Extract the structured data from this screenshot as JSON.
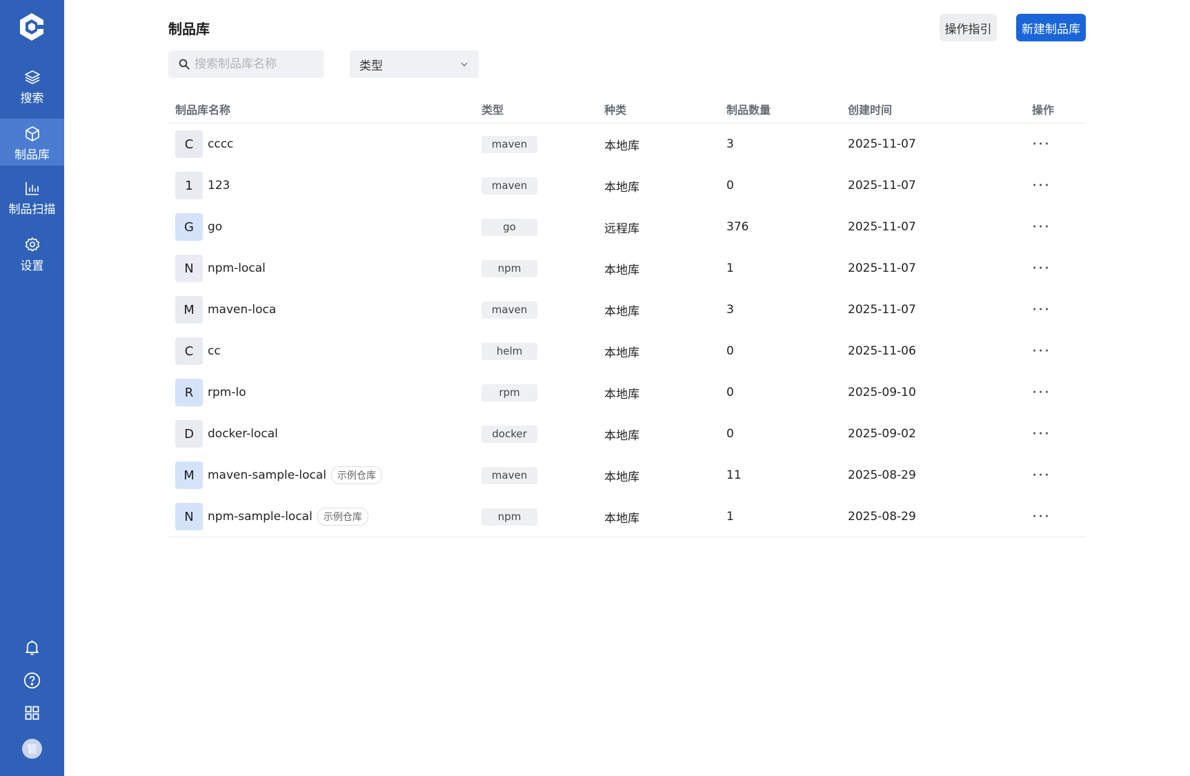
{
  "sidebar": {
    "items": [
      {
        "label": "搜索",
        "icon": "layers-icon"
      },
      {
        "label": "制品库",
        "icon": "box-icon"
      },
      {
        "label": "制品扫描",
        "icon": "bar-chart-icon"
      },
      {
        "label": "设置",
        "icon": "gear-icon"
      }
    ],
    "avatar_text": "管"
  },
  "header": {
    "title": "制品库",
    "guide_label": "操作指引",
    "new_label": "新建制品库"
  },
  "filters": {
    "search_placeholder": "搜索制品库名称",
    "type_label": "类型"
  },
  "table": {
    "columns": [
      "制品库名称",
      "类型",
      "种类",
      "制品数量",
      "创建时间",
      "操作"
    ],
    "rows": [
      {
        "letter": "C",
        "letter_bg": "#e8ebf0",
        "name": "cccc",
        "tag": "",
        "type": "maven",
        "kind": "本地库",
        "count": "3",
        "date": "2025-11-07"
      },
      {
        "letter": "1",
        "letter_bg": "#e8ebf0",
        "name": "123",
        "tag": "",
        "type": "maven",
        "kind": "本地库",
        "count": "0",
        "date": "2025-11-07"
      },
      {
        "letter": "G",
        "letter_bg": "#d4e3fa",
        "name": "go",
        "tag": "",
        "type": "go",
        "kind": "远程库",
        "count": "376",
        "date": "2025-11-07"
      },
      {
        "letter": "N",
        "letter_bg": "#e9ebf5",
        "name": "npm-local",
        "tag": "",
        "type": "npm",
        "kind": "本地库",
        "count": "1",
        "date": "2025-11-07"
      },
      {
        "letter": "M",
        "letter_bg": "#e8ebf0",
        "name": "maven-loca",
        "tag": "",
        "type": "maven",
        "kind": "本地库",
        "count": "3",
        "date": "2025-11-07"
      },
      {
        "letter": "C",
        "letter_bg": "#e8ebf0",
        "name": "cc",
        "tag": "",
        "type": "helm",
        "kind": "本地库",
        "count": "0",
        "date": "2025-11-06"
      },
      {
        "letter": "R",
        "letter_bg": "#d4e3fa",
        "name": "rpm-lo",
        "tag": "",
        "type": "rpm",
        "kind": "本地库",
        "count": "0",
        "date": "2025-09-10"
      },
      {
        "letter": "D",
        "letter_bg": "#e8ebf0",
        "name": "docker-local",
        "tag": "",
        "type": "docker",
        "kind": "本地库",
        "count": "0",
        "date": "2025-09-02"
      },
      {
        "letter": "M",
        "letter_bg": "#d4e3fa",
        "name": "maven-sample-local",
        "tag": "示例仓库",
        "type": "maven",
        "kind": "本地库",
        "count": "11",
        "date": "2025-08-29"
      },
      {
        "letter": "N",
        "letter_bg": "#d4e3fa",
        "name": "npm-sample-local",
        "tag": "示例仓库",
        "type": "npm",
        "kind": "本地库",
        "count": "1",
        "date": "2025-08-29"
      }
    ],
    "more_label": "···"
  },
  "colors": {
    "sidebar": "#2f61b8",
    "sidebar_active": "#4a7dd1",
    "primary": "#1a66d9"
  }
}
